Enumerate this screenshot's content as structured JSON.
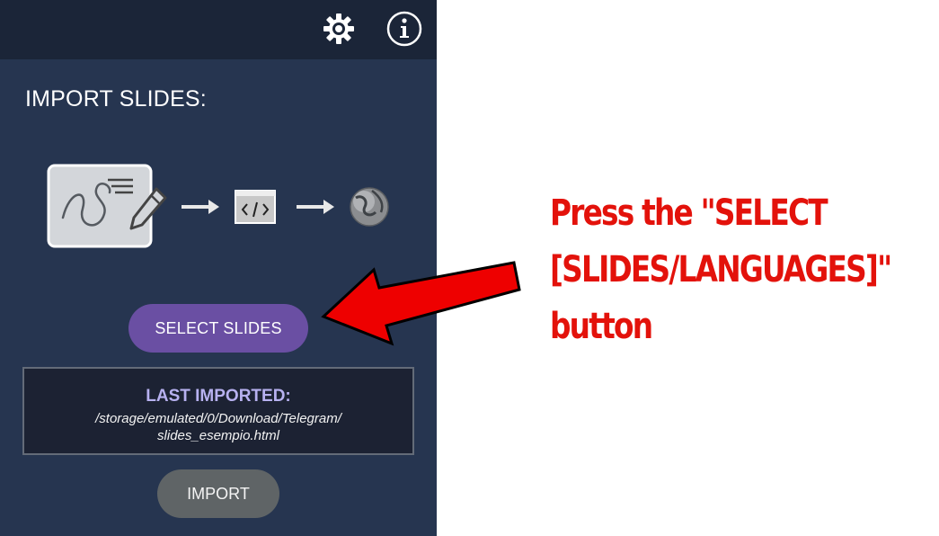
{
  "topbar": {
    "icons": [
      "gear-icon",
      "info-icon"
    ]
  },
  "import_section": {
    "title": "IMPORT SLIDES:",
    "illustration_icons": [
      "slide-drawing-icon",
      "arrow-right-icon",
      "html-code-icon",
      "arrow-right-icon",
      "globe-icon"
    ],
    "select_button_label": "SELECT SLIDES",
    "last_imported": {
      "title": "LAST IMPORTED:",
      "path_line1": "/storage/emulated/0/Download/Telegram/",
      "path_line2": "slides_esempio.html"
    },
    "import_button_label": "IMPORT"
  },
  "annotation": {
    "line1": "Press the \"SELECT",
    "line2": "[SLIDES/LANGUAGES]\"",
    "line3": "button",
    "color": "#e3120b",
    "arrow_color": "#ee0000"
  }
}
